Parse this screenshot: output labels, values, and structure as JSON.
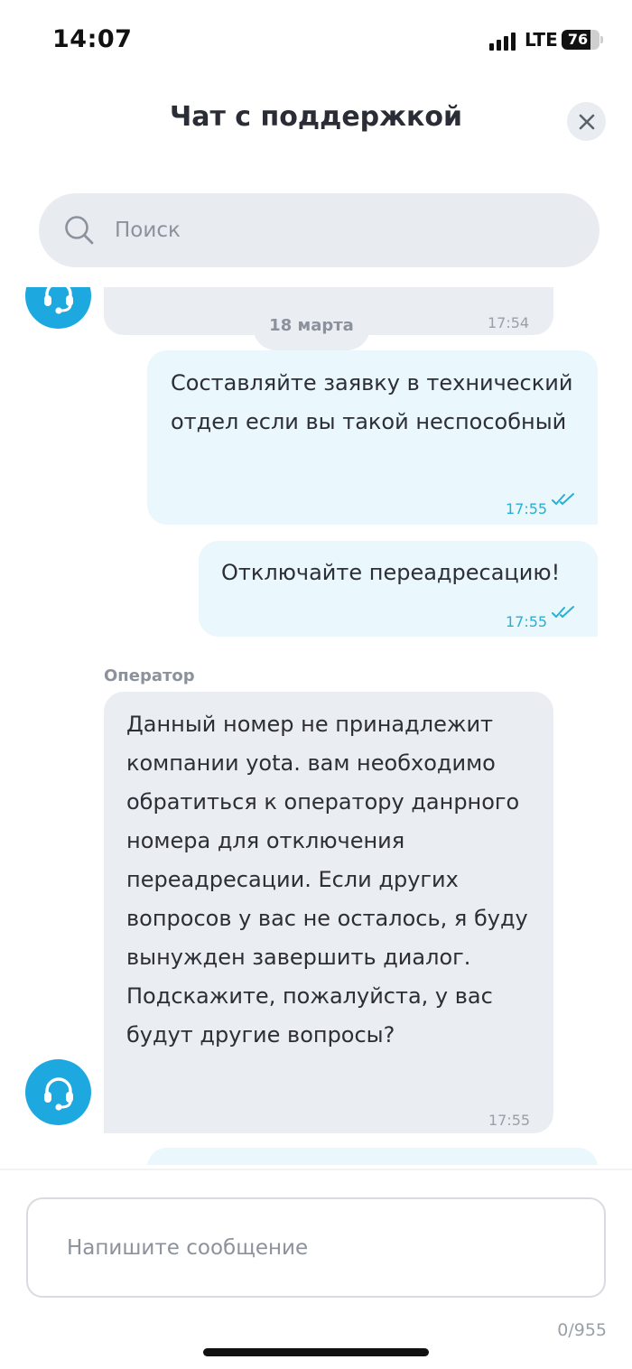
{
  "status_bar": {
    "time": "14:07",
    "network": "LTE",
    "battery": "76"
  },
  "header": {
    "title": "Чат с поддержкой"
  },
  "search": {
    "placeholder": "Поиск"
  },
  "chat": {
    "date_separator": "18 марта",
    "messages": [
      {
        "direction": "incoming",
        "text": "",
        "time": "17:54"
      },
      {
        "direction": "outgoing",
        "text": "Составляйте заявку в технический отдел если вы такой неспособный",
        "time": "17:55",
        "status": "read"
      },
      {
        "direction": "outgoing",
        "text": "Отключайте переадресацию!",
        "time": "17:55",
        "status": "read"
      },
      {
        "direction": "incoming",
        "sender": "Оператор",
        "text": "Данный номер не принадлежит компании yota. вам необходимо обратиться к оператору данрного номера для отключения переадресации. Если других вопросов у вас не осталось, я буду вынужден завершить диалог. Подскажите, пожалуйста, у вас будут другие вопросы?",
        "time": "17:55"
      }
    ]
  },
  "composer": {
    "placeholder": "Напишите сообщение",
    "counter": "0/955"
  },
  "colors": {
    "accent": "#1ea8e0",
    "incoming_bubble": "#eaedf2",
    "outgoing_bubble": "#eaf7fc",
    "read_ticks": "#25b1d6"
  },
  "icons": {
    "close": "close-icon",
    "search": "search-icon",
    "avatar": "headset-icon",
    "read_status": "double-check-icon"
  }
}
